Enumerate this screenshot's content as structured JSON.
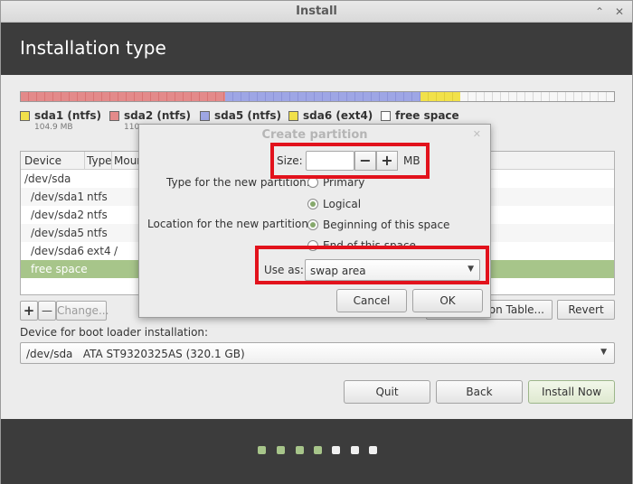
{
  "window": {
    "title": "Install",
    "minimize_icon": "chevron-up-icon",
    "close_icon": "close-icon"
  },
  "header": {
    "title": "Installation type"
  },
  "colors": {
    "sda1": "#d97373",
    "sda2": "#e38a8a",
    "sda5": "#9ea6e5",
    "sda6": "#f1e14a",
    "free": "#ffffff",
    "selected": "#a7c58a",
    "highlight": "#e2121c"
  },
  "legend": [
    {
      "name": "sda1 (ntfs)",
      "size": "104.9 MB",
      "color": "#f1e14a"
    },
    {
      "name": "sda2 (ntfs)",
      "size": "110",
      "color": "#e38a8a"
    },
    {
      "name": "sda5 (ntfs)",
      "size": "",
      "color": "#9ea6e5"
    },
    {
      "name": "sda6 (ext4)",
      "size": "",
      "color": "#f1e14a"
    },
    {
      "name": "free space",
      "size": "",
      "color": "#ffffff"
    }
  ],
  "table": {
    "headers": {
      "device": "Device",
      "type": "Type",
      "mount": "Moun"
    },
    "rows": [
      {
        "device": "/dev/sda",
        "type": "",
        "mount": ""
      },
      {
        "device": "/dev/sda1",
        "type": "ntfs",
        "mount": ""
      },
      {
        "device": "/dev/sda2",
        "type": "ntfs",
        "mount": ""
      },
      {
        "device": "/dev/sda5",
        "type": "ntfs",
        "mount": ""
      },
      {
        "device": "/dev/sda6",
        "type": "ext4",
        "mount": "/"
      },
      {
        "device": "free space",
        "type": "",
        "mount": ""
      }
    ]
  },
  "table_buttons": {
    "add": "+",
    "remove": "—",
    "change": "Change...",
    "new_table": "tion Table...",
    "revert": "Revert"
  },
  "boot": {
    "label": "Device for boot loader installation:",
    "value": "/dev/sda   ATA ST9320325AS (320.1 GB)"
  },
  "nav": {
    "quit": "Quit",
    "back": "Back",
    "install": "Install Now"
  },
  "progress": {
    "steps_total": 7,
    "steps_done": 4
  },
  "dialog": {
    "title": "Create partition",
    "size_label": "Size:",
    "size_value": "",
    "size_unit": "MB",
    "minus": "−",
    "plus": "+",
    "type_label": "Type for the new partition:",
    "type_primary": "Primary",
    "type_logical": "Logical",
    "location_label": "Location for the new partition:",
    "location_beginning": "Beginning of this space",
    "location_end": "End of this space",
    "use_as_label": "Use as:",
    "use_as_value": "swap area",
    "cancel": "Cancel",
    "ok": "OK"
  }
}
